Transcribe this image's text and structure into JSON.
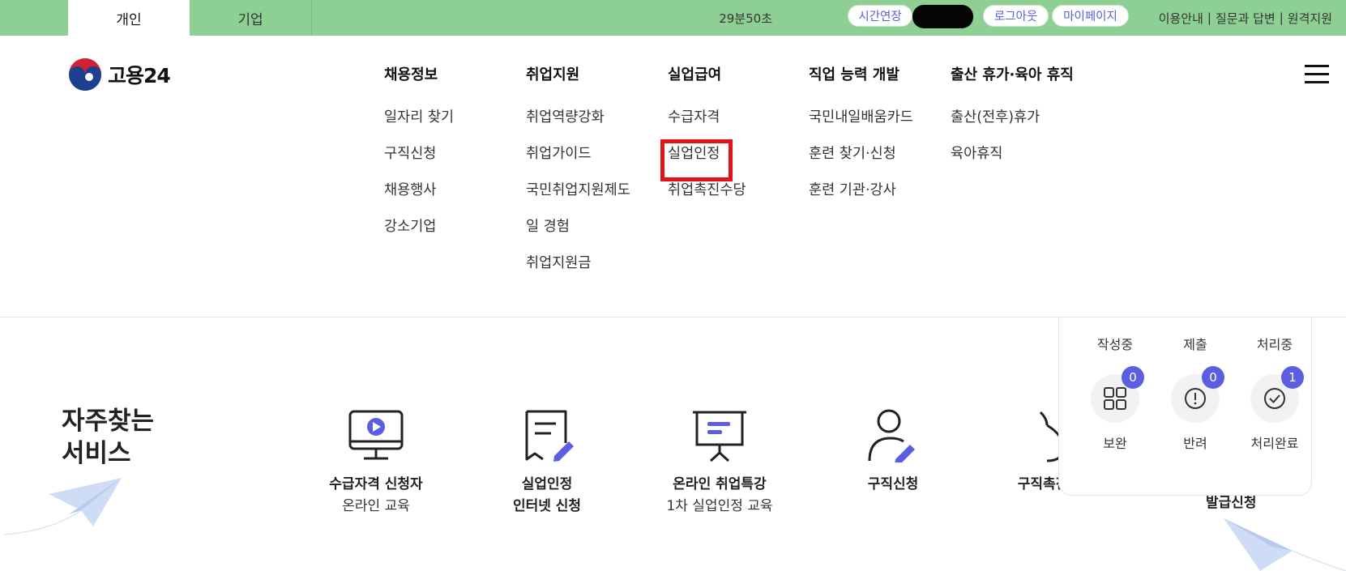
{
  "topbar": {
    "tabs": [
      "개인",
      "기업"
    ],
    "timer": "29분50초",
    "extend_label": "시간연장",
    "logout_label": "로그아웃",
    "mypage_label": "마이페이지",
    "links": [
      "이용안내",
      "질문과 답변",
      "원격지원"
    ],
    "bg_color": "#8ecf94"
  },
  "header": {
    "logo_text": "고용24",
    "menu": [
      {
        "title": "채용정보",
        "items": [
          "일자리 찾기",
          "구직신청",
          "채용행사",
          "강소기업"
        ]
      },
      {
        "title": "취업지원",
        "items": [
          "취업역량강화",
          "취업가이드",
          "국민취업지원제도",
          "일 경험",
          "취업지원금"
        ]
      },
      {
        "title": "실업급여",
        "items": [
          "수급자격",
          "실업인정",
          "취업촉진수당"
        ]
      },
      {
        "title": "직업 능력 개발",
        "items": [
          "국민내일배움카드",
          "훈련 찾기·신청",
          "훈련 기관·강사"
        ]
      },
      {
        "title": "출산 휴가·육아 휴직",
        "items": [
          "출산(전후)휴가",
          "육아휴직"
        ]
      }
    ],
    "highlighted_item": "실업인정",
    "highlight_color": "#e0141b"
  },
  "frequent": {
    "title_line1": "자주찾는",
    "title_line2": "서비스",
    "services": [
      {
        "icon": "monitor-play-icon",
        "line1": "수급자격 신청자",
        "line2": "온라인 교육"
      },
      {
        "icon": "document-pen-icon",
        "line1": "실업인정",
        "line2": "인터넷 신청"
      },
      {
        "icon": "presentation-board-icon",
        "line1": "온라인 취업특강",
        "line2": "1차 실업인정 교육"
      },
      {
        "icon": "person-pen-icon",
        "line1": "구직신청",
        "line2": ""
      },
      {
        "icon": "money-bag-icon",
        "line1": "구직촉진",
        "line2": ""
      }
    ],
    "issue_label": "발급신청"
  },
  "status": {
    "top_labels": [
      "작성중",
      "제출",
      "처리중"
    ],
    "items": [
      {
        "label": "보완",
        "count": "0",
        "icon": "grid-icon"
      },
      {
        "label": "반려",
        "count": "0",
        "icon": "exclamation-circle-icon"
      },
      {
        "label": "처리완료",
        "count": "1",
        "icon": "check-circle-icon"
      }
    ],
    "badge_color": "#5b5ee0"
  }
}
